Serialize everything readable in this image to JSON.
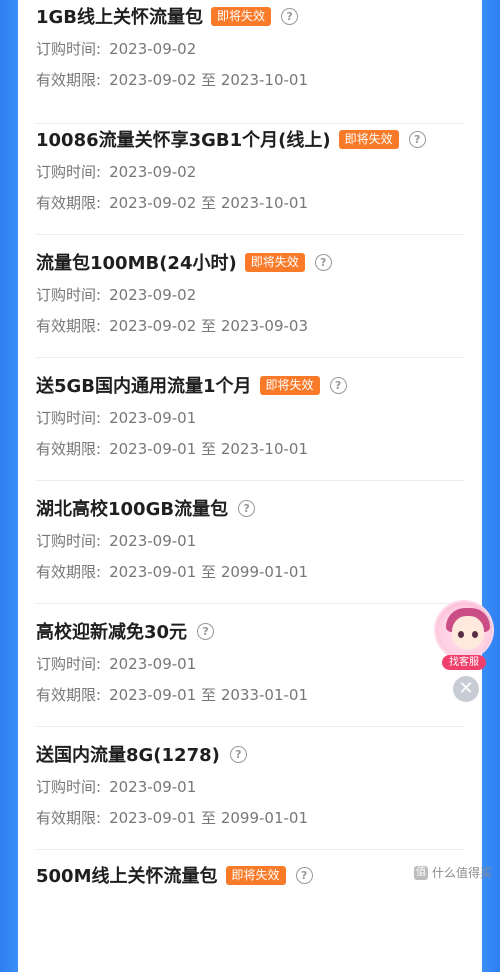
{
  "labels": {
    "order_time": "订购时间:",
    "valid_period": "有效期限:",
    "to": "至",
    "expiring": "即将失效",
    "help_glyph": "?"
  },
  "items": [
    {
      "title": "1GB线上关怀流量包",
      "expiring": true,
      "order_date": "2023-09-02",
      "valid_from": "2023-09-02",
      "valid_to": "2023-10-01"
    },
    {
      "title": "10086流量关怀享3GB1个月(线上)",
      "expiring": true,
      "order_date": "2023-09-02",
      "valid_from": "2023-09-02",
      "valid_to": "2023-10-01"
    },
    {
      "title": "流量包100MB(24小时)",
      "expiring": true,
      "order_date": "2023-09-02",
      "valid_from": "2023-09-02",
      "valid_to": "2023-09-03"
    },
    {
      "title": "送5GB国内通用流量1个月",
      "expiring": true,
      "order_date": "2023-09-01",
      "valid_from": "2023-09-01",
      "valid_to": "2023-10-01"
    },
    {
      "title": "湖北高校100GB流量包",
      "expiring": false,
      "order_date": "2023-09-01",
      "valid_from": "2023-09-01",
      "valid_to": "2099-01-01"
    },
    {
      "title": "高校迎新减免30元",
      "expiring": false,
      "order_date": "2023-09-01",
      "valid_from": "2023-09-01",
      "valid_to": "2033-01-01"
    },
    {
      "title": "送国内流量8G(1278)",
      "expiring": false,
      "order_date": "2023-09-01",
      "valid_from": "2023-09-01",
      "valid_to": "2099-01-01"
    },
    {
      "title": "500M线上关怀流量包",
      "expiring": true
    }
  ],
  "customer_service": {
    "label": "找客服",
    "close_glyph": "✕"
  },
  "watermark": {
    "logo": "值",
    "text": "什么值得买"
  },
  "colors": {
    "accent_blue": "#3a8ef6",
    "badge_orange": "#f97b2a",
    "cs_badge": "#ef3f6d"
  }
}
